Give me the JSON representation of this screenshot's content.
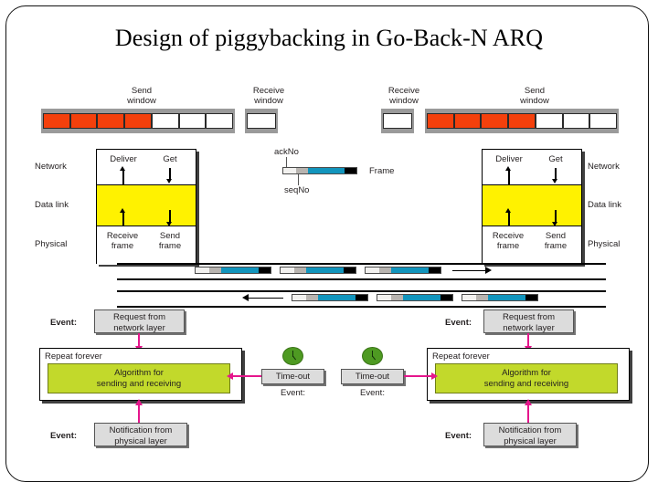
{
  "slide": {
    "title": "Design of piggybacking in Go-Back-N ARQ"
  },
  "windows": {
    "left_send": {
      "label_line1": "Send",
      "label_line2": "window",
      "cells": [
        "sent",
        "sent",
        "sent",
        "sent",
        "free",
        "free",
        "free"
      ]
    },
    "left_receive": {
      "label_line1": "Receive",
      "label_line2": "window",
      "cells": [
        "free"
      ]
    },
    "right_receive": {
      "label_line1": "Receive",
      "label_line2": "window",
      "cells": [
        "free"
      ]
    },
    "right_send": {
      "label_line1": "Send",
      "label_line2": "window",
      "cells": [
        "sent",
        "sent",
        "sent",
        "sent",
        "free",
        "free",
        "free"
      ]
    },
    "colors": {
      "sent": "#f4400c",
      "free": "#ffffff",
      "strip": "#9a9a9a"
    }
  },
  "frame_legend": {
    "ackno_label": "ackNo",
    "seqno_label": "seqNo",
    "frame_label": "Frame",
    "segments": [
      "ackNo",
      "seqNo",
      "data",
      "tail"
    ],
    "colors": {
      "ackno": "#f2f1ef",
      "seqno": "#b8b4b0",
      "data": "#1295bd",
      "tail": "#000000"
    }
  },
  "stacks": {
    "left": {
      "layers": [
        "Network",
        "Data link",
        "Physical"
      ],
      "deliver_label": "Deliver",
      "get_label": "Get",
      "receive_frame_line1": "Receive",
      "receive_frame_line2": "frame",
      "send_frame_line1": "Send",
      "send_frame_line2": "frame",
      "datalink_color": "#fff200"
    },
    "right": {
      "layers": [
        "Network",
        "Data link",
        "Physical"
      ],
      "deliver_label": "Deliver",
      "get_label": "Get",
      "receive_frame_line1": "Receive",
      "receive_frame_line2": "frame",
      "send_frame_line1": "Send",
      "send_frame_line2": "frame",
      "datalink_color": "#fff200"
    }
  },
  "channels": {
    "upper": {
      "direction": "right",
      "frame_count": 3
    },
    "lower": {
      "direction": "left",
      "frame_count": 3
    }
  },
  "algorithm_left": {
    "event_top_tag": "Event:",
    "event_top_line1": "Request from",
    "event_top_line2": "network layer",
    "repeat_label": "Repeat forever",
    "algo_line1": "Algorithm for",
    "algo_line2": "sending and receiving",
    "event_bottom_tag": "Event:",
    "event_bottom_line1": "Notification from",
    "event_bottom_line2": "physical layer",
    "algo_color": "#c2d92b"
  },
  "algorithm_right": {
    "event_top_tag": "Event:",
    "event_top_line1": "Request from",
    "event_top_line2": "network layer",
    "repeat_label": "Repeat forever",
    "algo_line1": "Algorithm for",
    "algo_line2": "sending and receiving",
    "event_bottom_tag": "Event:",
    "event_bottom_line1": "Notification from",
    "event_bottom_line2": "physical layer",
    "algo_color": "#c2d92b"
  },
  "timers": {
    "left": {
      "timeout_label": "Time-out",
      "event_tag": "Event:",
      "icon": "clock-icon",
      "color": "#4e9a22"
    },
    "right": {
      "timeout_label": "Time-out",
      "event_tag": "Event:",
      "icon": "clock-icon",
      "color": "#4e9a22"
    }
  },
  "accent": {
    "connector": "#e5168c",
    "frame_data": "#1295bd",
    "window_sent": "#f4400c",
    "datalink": "#fff200",
    "algorithm": "#c2d92b",
    "timer": "#4e9a22"
  }
}
